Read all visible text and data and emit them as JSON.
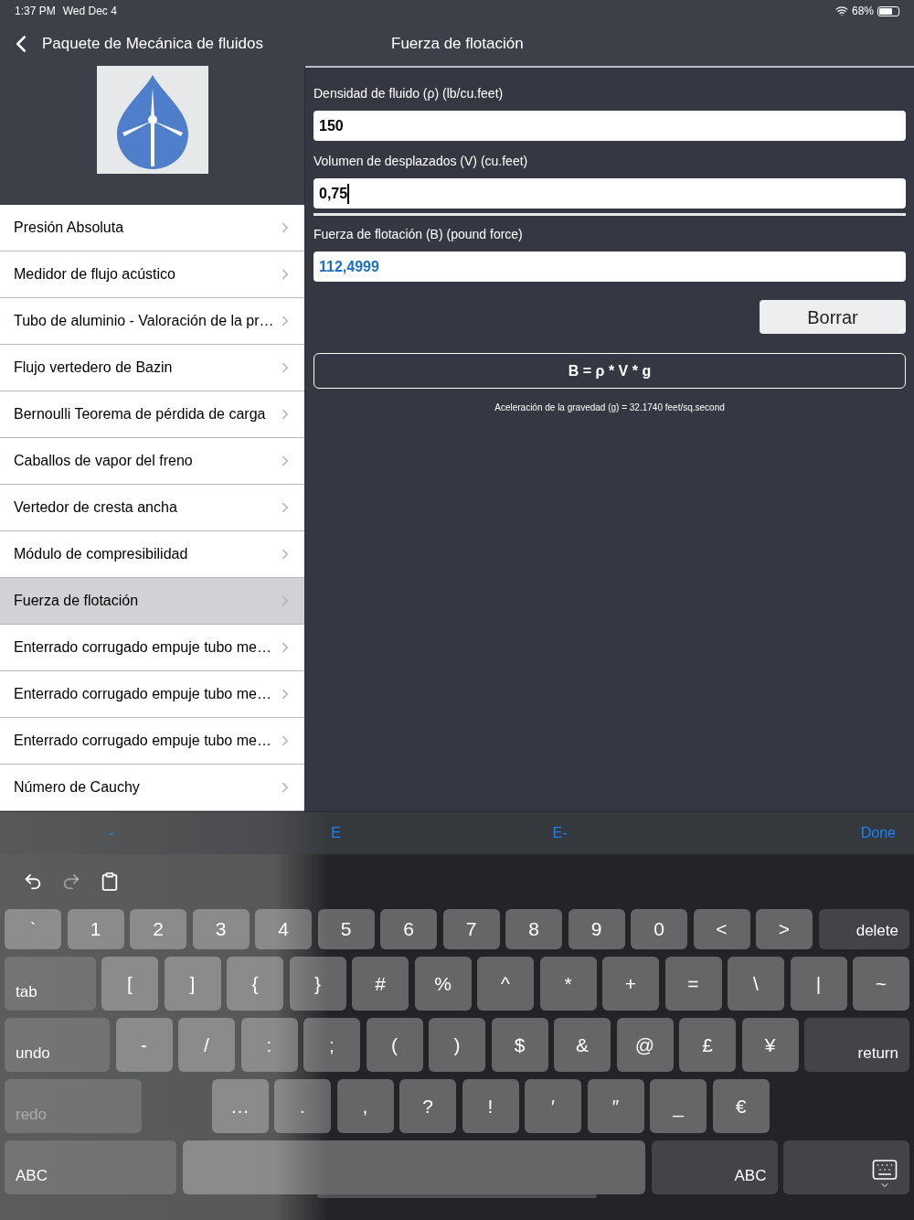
{
  "status_bar": {
    "time": "1:37 PM",
    "date": "Wed Dec 4",
    "battery": "68%"
  },
  "nav": {
    "back_label": "Paquete de Mecánica de fluidos",
    "title": "Fuerza de flotación"
  },
  "sidebar": {
    "items": [
      {
        "label": "Presión Absoluta",
        "selected": false
      },
      {
        "label": "Medidor de flujo acústico",
        "selected": false
      },
      {
        "label": "Tubo de aluminio - Valoración de la pr…",
        "selected": false
      },
      {
        "label": "Flujo vertedero de Bazin",
        "selected": false
      },
      {
        "label": "Bernoulli Teorema de pérdida de carga",
        "selected": false
      },
      {
        "label": "Caballos de vapor del freno",
        "selected": false
      },
      {
        "label": "Vertedor de cresta ancha",
        "selected": false
      },
      {
        "label": "Módulo de compresibilidad",
        "selected": false
      },
      {
        "label": "Fuerza de flotación",
        "selected": true
      },
      {
        "label": "Enterrado corrugado empuje tubo me…",
        "selected": false
      },
      {
        "label": "Enterrado corrugado empuje tubo me…",
        "selected": false
      },
      {
        "label": "Enterrado corrugado empuje tubo me…",
        "selected": false
      },
      {
        "label": "Número de Cauchy",
        "selected": false
      }
    ]
  },
  "form": {
    "fields": [
      {
        "label": "Densidad de fluido (ρ) (lb/cu.feet)",
        "value": "150",
        "kind": "input",
        "focused": false
      },
      {
        "label": "Volumen de desplazados (V) (cu.feet)",
        "value": "0,75",
        "kind": "input",
        "focused": true
      },
      {
        "label": "Fuerza de flotación (B) (pound force)",
        "value": "112,4999",
        "kind": "output",
        "focused": false
      }
    ],
    "clear_button": "Borrar",
    "formula": "B = ρ * V * g",
    "note": "Aceleración de la gravedad (g) = 32.1740 feet/sq.second"
  },
  "keyboard": {
    "accessory": [
      "-",
      "E",
      "E-",
      "Done"
    ],
    "toolbar": [
      {
        "kind": "undo",
        "disabled": false
      },
      {
        "kind": "redo",
        "disabled": true
      },
      {
        "kind": "paste",
        "disabled": false
      }
    ],
    "rows": [
      {
        "keys": [
          {
            "label": "`",
            "kind": "char"
          },
          {
            "label": "1",
            "kind": "char"
          },
          {
            "label": "2",
            "kind": "char"
          },
          {
            "label": "3",
            "kind": "char"
          },
          {
            "label": "4",
            "kind": "char"
          },
          {
            "label": "5",
            "kind": "char"
          },
          {
            "label": "6",
            "kind": "char"
          },
          {
            "label": "7",
            "kind": "char"
          },
          {
            "label": "8",
            "kind": "char"
          },
          {
            "label": "9",
            "kind": "char"
          },
          {
            "label": "0",
            "kind": "char"
          },
          {
            "label": "<",
            "kind": "char"
          },
          {
            "label": ">",
            "kind": "char"
          },
          {
            "label": "delete",
            "kind": "right"
          }
        ]
      },
      {
        "keys": [
          {
            "label": "tab",
            "kind": "left"
          },
          {
            "label": "[",
            "kind": "char"
          },
          {
            "label": "]",
            "kind": "char"
          },
          {
            "label": "{",
            "kind": "char"
          },
          {
            "label": "}",
            "kind": "char"
          },
          {
            "label": "#",
            "kind": "char"
          },
          {
            "label": "%",
            "kind": "char"
          },
          {
            "label": "^",
            "kind": "char"
          },
          {
            "label": "*",
            "kind": "char"
          },
          {
            "label": "+",
            "kind": "char"
          },
          {
            "label": "=",
            "kind": "char"
          },
          {
            "label": "\\",
            "kind": "char"
          },
          {
            "label": "|",
            "kind": "char"
          },
          {
            "label": "~",
            "kind": "char"
          }
        ]
      },
      {
        "keys": [
          {
            "label": "undo",
            "kind": "left"
          },
          {
            "label": "-",
            "kind": "char"
          },
          {
            "label": "/",
            "kind": "char"
          },
          {
            "label": ":",
            "kind": "char"
          },
          {
            "label": ";",
            "kind": "char"
          },
          {
            "label": "(",
            "kind": "char"
          },
          {
            "label": ")",
            "kind": "char"
          },
          {
            "label": "$",
            "kind": "char"
          },
          {
            "label": "&",
            "kind": "char"
          },
          {
            "label": "@",
            "kind": "char"
          },
          {
            "label": "£",
            "kind": "char"
          },
          {
            "label": "¥",
            "kind": "char"
          },
          {
            "label": "return",
            "kind": "right"
          }
        ]
      },
      {
        "keys": [
          {
            "label": "redo",
            "kind": "left",
            "disabled": true
          },
          {
            "label": "…",
            "kind": "char"
          },
          {
            "label": ".",
            "kind": "char"
          },
          {
            "label": ",",
            "kind": "char"
          },
          {
            "label": "?",
            "kind": "char"
          },
          {
            "label": "!",
            "kind": "char"
          },
          {
            "label": "′",
            "kind": "char"
          },
          {
            "label": "″",
            "kind": "char"
          },
          {
            "label": "_",
            "kind": "char"
          },
          {
            "label": "€",
            "kind": "char"
          }
        ]
      },
      {
        "keys": [
          {
            "label": "ABC",
            "kind": "left"
          },
          {
            "kind": "space"
          },
          {
            "label": "ABC",
            "kind": "right"
          },
          {
            "kind": "hide"
          }
        ]
      }
    ]
  }
}
